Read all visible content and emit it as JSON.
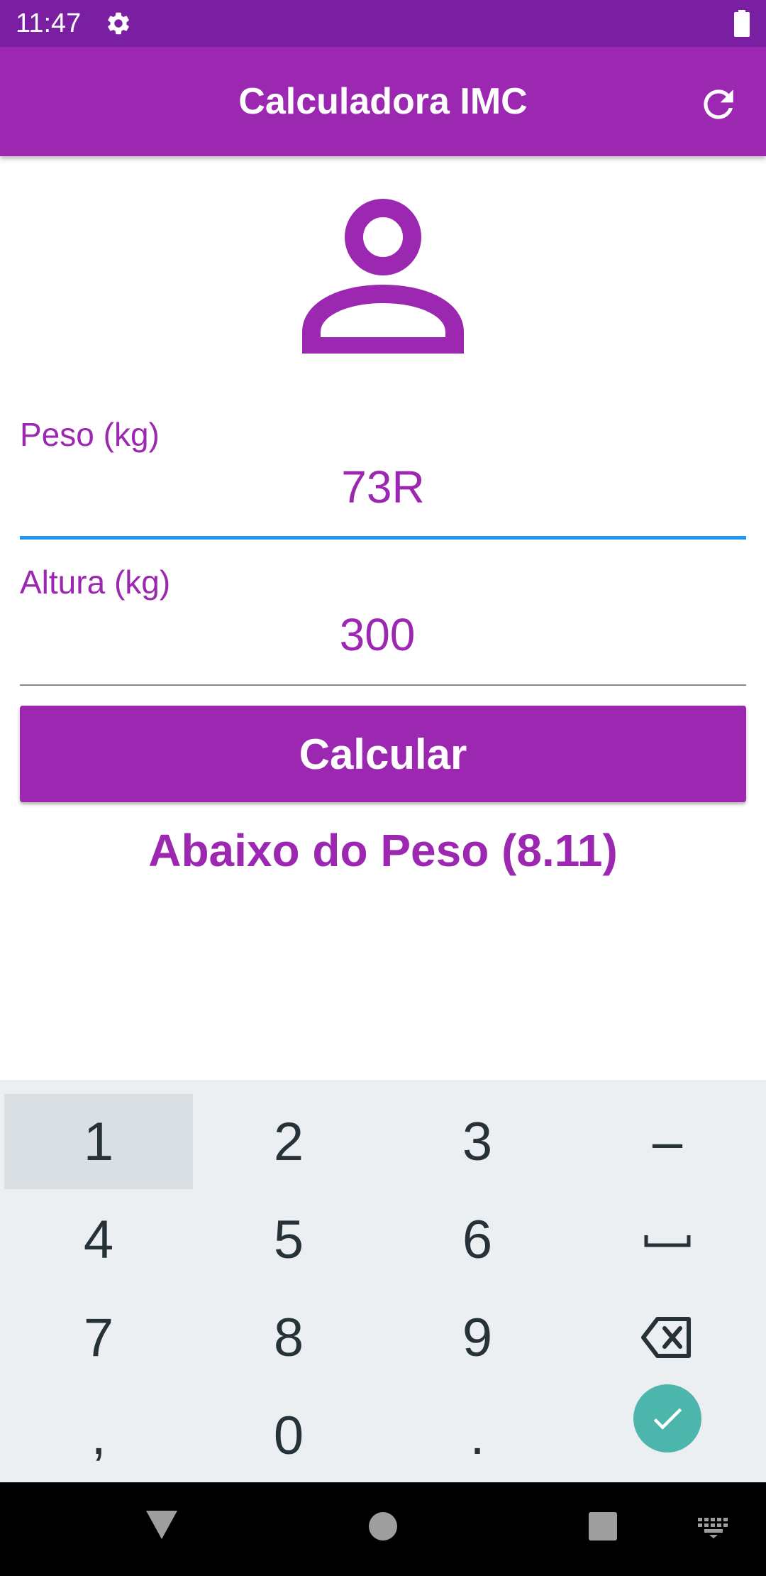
{
  "status_bar": {
    "time": "11:47",
    "icons": [
      "settings-gear-icon",
      "battery-full-icon"
    ]
  },
  "app_bar": {
    "title": "Calculadora IMC",
    "action_icon": "refresh-icon"
  },
  "avatar_icon": "person-outline-icon",
  "form": {
    "peso": {
      "label": "Peso (kg)",
      "value": "73R",
      "focused": true
    },
    "altura": {
      "label": "Altura (kg)",
      "value": "300",
      "focused": false
    },
    "button_label": "Calcular"
  },
  "result": {
    "text": "Abaixo do Peso (8.11)"
  },
  "keyboard": {
    "keys": [
      [
        "1",
        "2",
        "3",
        "–"
      ],
      [
        "4",
        "5",
        "6",
        "space-icon"
      ],
      [
        "7",
        "8",
        "9",
        "backspace-icon"
      ],
      [
        ",",
        "0",
        ".",
        "done-check-icon"
      ]
    ],
    "pressed_key": "1"
  },
  "nav_bar": {
    "icons": [
      "back-triangle-icon",
      "home-circle-icon",
      "recents-square-icon",
      "keyboard-switch-icon"
    ]
  },
  "colors": {
    "status_bar": "#7b1fa2",
    "primary": "#9c27b0",
    "focus_underline": "#2196f3",
    "keyboard_bg": "#eceff1",
    "done_key": "#4db6ac"
  }
}
